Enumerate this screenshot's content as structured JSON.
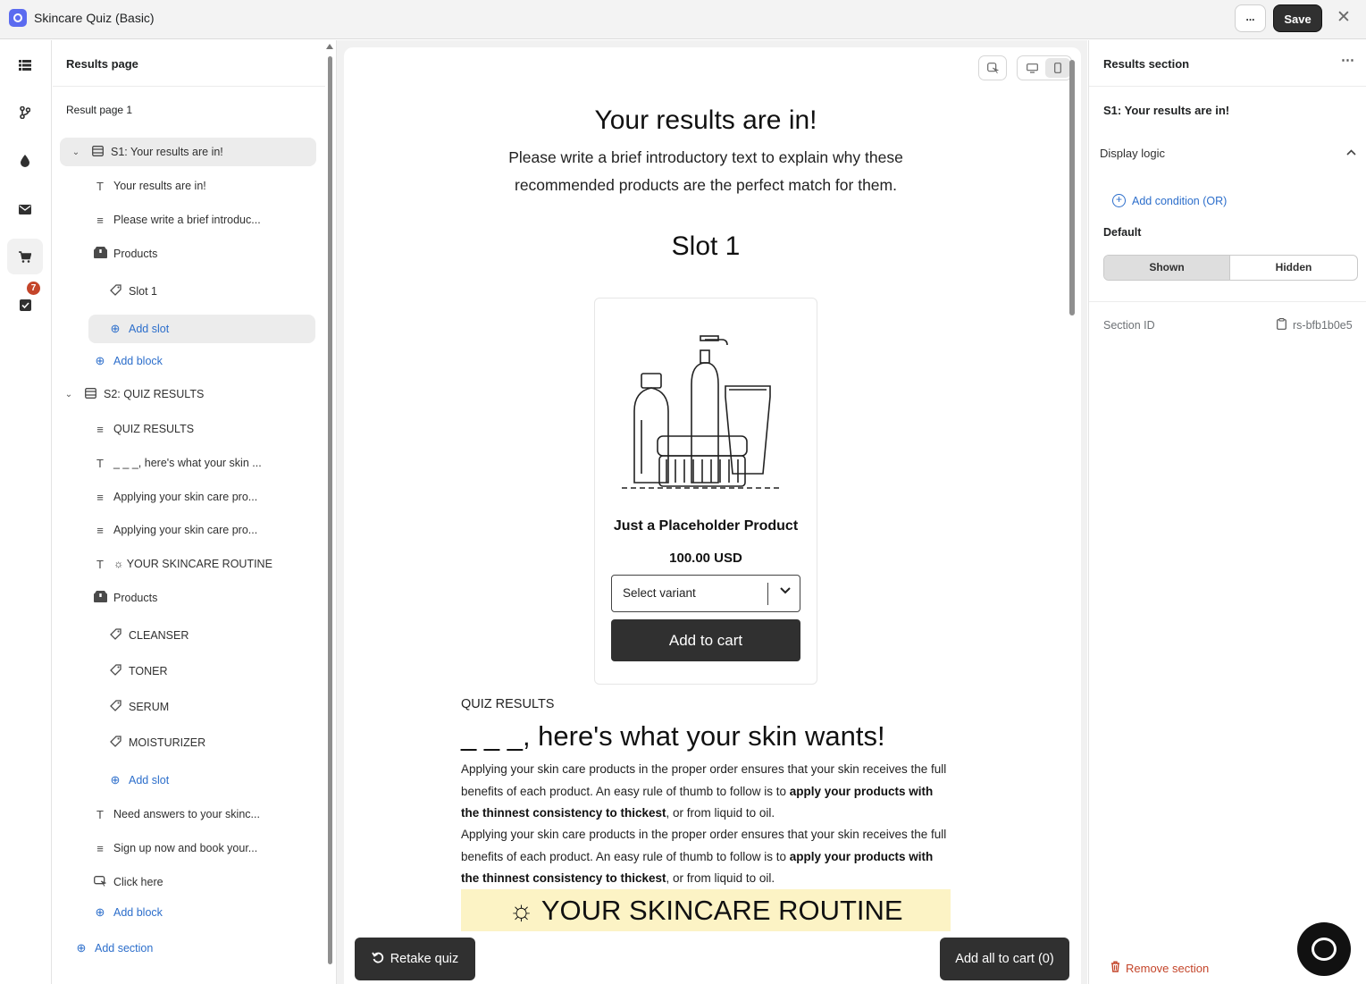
{
  "window": {
    "title": "Skincare Quiz (Basic)",
    "more_label": "...",
    "save_label": "Save",
    "close_glyph": "✕"
  },
  "rail": {
    "badge_count": "7",
    "icons": [
      "list-icon",
      "branch-icon",
      "drop-icon",
      "mail-icon",
      "cart-icon",
      "checklist-icon"
    ]
  },
  "outline": {
    "title": "Results page",
    "subtitle": "Result page 1",
    "items": [
      {
        "label": "S1: Your results are in!"
      },
      {
        "label": "Your results are in!"
      },
      {
        "label": "Please write a brief introduc..."
      },
      {
        "label": "Products"
      },
      {
        "label": "Slot 1"
      },
      {
        "label": "Add slot"
      },
      {
        "label": "Add block"
      },
      {
        "label": "S2: QUIZ RESULTS"
      },
      {
        "label": "QUIZ RESULTS"
      },
      {
        "label": "_ _ _, here's what your skin ..."
      },
      {
        "label": "Applying your skin care pro..."
      },
      {
        "label": "Applying your skin care pro..."
      },
      {
        "label": "☼ YOUR SKINCARE ROUTINE"
      },
      {
        "label": "Products"
      },
      {
        "label": "CLEANSER"
      },
      {
        "label": "TONER"
      },
      {
        "label": "SERUM"
      },
      {
        "label": "MOISTURIZER"
      },
      {
        "label": "Add slot"
      },
      {
        "label": "Need answers to your skinc..."
      },
      {
        "label": "Sign up now and book your..."
      },
      {
        "label": "Click here"
      },
      {
        "label": "Add block"
      },
      {
        "label": "Add section"
      }
    ]
  },
  "preview": {
    "heading": "Your results are in!",
    "intro": "Please write a brief introductory text to explain why these recommended products are the perfect match for them.",
    "slot_title": "Slot 1",
    "product": {
      "name": "Just a Placeholder Product",
      "price": "100.00 USD",
      "variant_placeholder": "Select variant",
      "add_to_cart": "Add to cart"
    },
    "quiz_results_label": "QUIZ RESULTS",
    "skin_heading": "_ _ _, here's what your skin wants!",
    "para1": {
      "a": "Applying your skin care products in the proper order ensures that your skin receives the full benefits of each product. An easy rule of thumb to follow is to ",
      "bold": "apply your products with the thinnest consistency to thickest",
      "c": ", or from liquid to oil."
    },
    "para2": {
      "a": "Applying your skin care products in the proper order ensures that your skin receives the full benefits of each product. An easy rule of thumb to follow is to ",
      "bold": "apply your products with the thinnest consistency to thickest",
      "c": ", or from liquid to oil."
    },
    "routine": "☼ YOUR SKINCARE ROUTINE",
    "retake": "Retake quiz",
    "add_all": "Add all to cart (0)"
  },
  "right_panel": {
    "title": "Results section",
    "section_name": "S1: Your results are in!",
    "display_logic": "Display logic",
    "add_condition": "Add condition (OR)",
    "default_label": "Default",
    "shown": "Shown",
    "hidden": "Hidden",
    "default_selected": "Shown",
    "section_id_label": "Section ID",
    "section_id_value": "rs-bfb1b0e5",
    "remove": "Remove section"
  },
  "colors": {
    "accent": "#2c6ecb",
    "dark_button": "#303030",
    "danger": "#c4452a",
    "routine_bg": "#fcf3c5"
  }
}
